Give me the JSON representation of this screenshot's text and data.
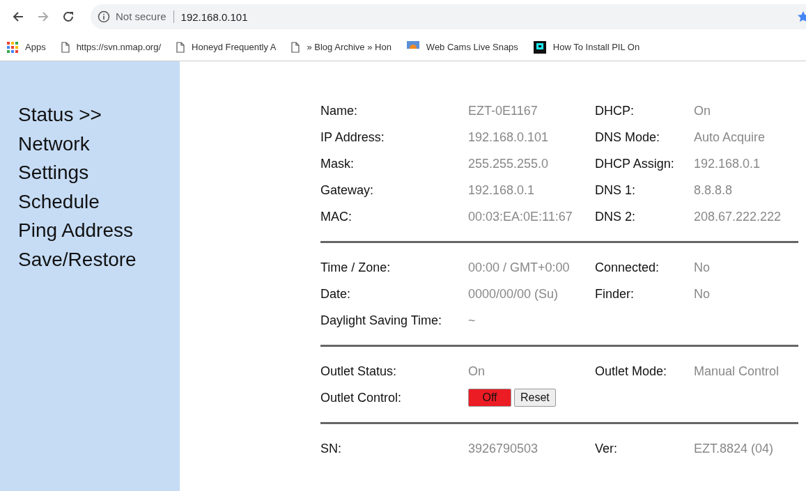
{
  "browser": {
    "security": "Not secure",
    "url": "192.168.0.101",
    "bookmarks": [
      {
        "label": "Apps",
        "kind": "apps"
      },
      {
        "label": "https://svn.nmap.org/",
        "kind": "page"
      },
      {
        "label": "Honeyd Frequently A",
        "kind": "page"
      },
      {
        "label": "» Blog Archive » Hon",
        "kind": "page"
      },
      {
        "label": "Web Cams Live Snaps",
        "kind": "wsc"
      },
      {
        "label": "How To Install PIL On",
        "kind": "square"
      }
    ]
  },
  "sidebar": {
    "items": [
      {
        "label": "Status >>"
      },
      {
        "label": "Network"
      },
      {
        "label": "Settings"
      },
      {
        "label": "Schedule"
      },
      {
        "label": "Ping Address"
      },
      {
        "label": "Save/Restore"
      }
    ]
  },
  "sections": [
    {
      "rows": [
        {
          "label": "Name:",
          "value": "EZT-0E1167",
          "label_2": "DHCP:",
          "value_2": "On"
        },
        {
          "label": "IP Address:",
          "value": "192.168.0.101",
          "label_2": "DNS Mode:",
          "value_2": "Auto Acquire"
        },
        {
          "label": "Mask:",
          "value": "255.255.255.0",
          "label_2": "DHCP Assign:",
          "value_2": "192.168.0.1"
        },
        {
          "label": "Gateway:",
          "value": "192.168.0.1",
          "label_2": "DNS 1:",
          "value_2": "8.8.8.8"
        },
        {
          "label": "MAC:",
          "value": "00:03:EA:0E:11:67",
          "label_2": "DNS 2:",
          "value_2": "208.67.222.222"
        }
      ]
    },
    {
      "rows": [
        {
          "label": "Time / Zone:",
          "value": "00:00 / GMT+0:00",
          "label_2": "Connected:",
          "value_2": "No"
        },
        {
          "label": "Date:",
          "value": "0000/00/00 (Su)",
          "label_2": "Finder:",
          "value_2": "No"
        },
        {
          "label": "Daylight Saving Time:",
          "value": "~"
        }
      ]
    },
    {
      "rows": [
        {
          "label": "Outlet Status:",
          "value": "On",
          "label_2": "Outlet Mode:",
          "value_2": "Manual Control"
        },
        {
          "label": "Outlet Control:",
          "buttons": [
            {
              "label": "Off",
              "kind": "danger"
            },
            {
              "label": "Reset",
              "kind": "plain"
            }
          ]
        }
      ]
    },
    {
      "rows": [
        {
          "label": "SN:",
          "value": "3926790503",
          "label_2": "Ver:",
          "value_2": "EZT.8824 (04)"
        }
      ]
    }
  ]
}
